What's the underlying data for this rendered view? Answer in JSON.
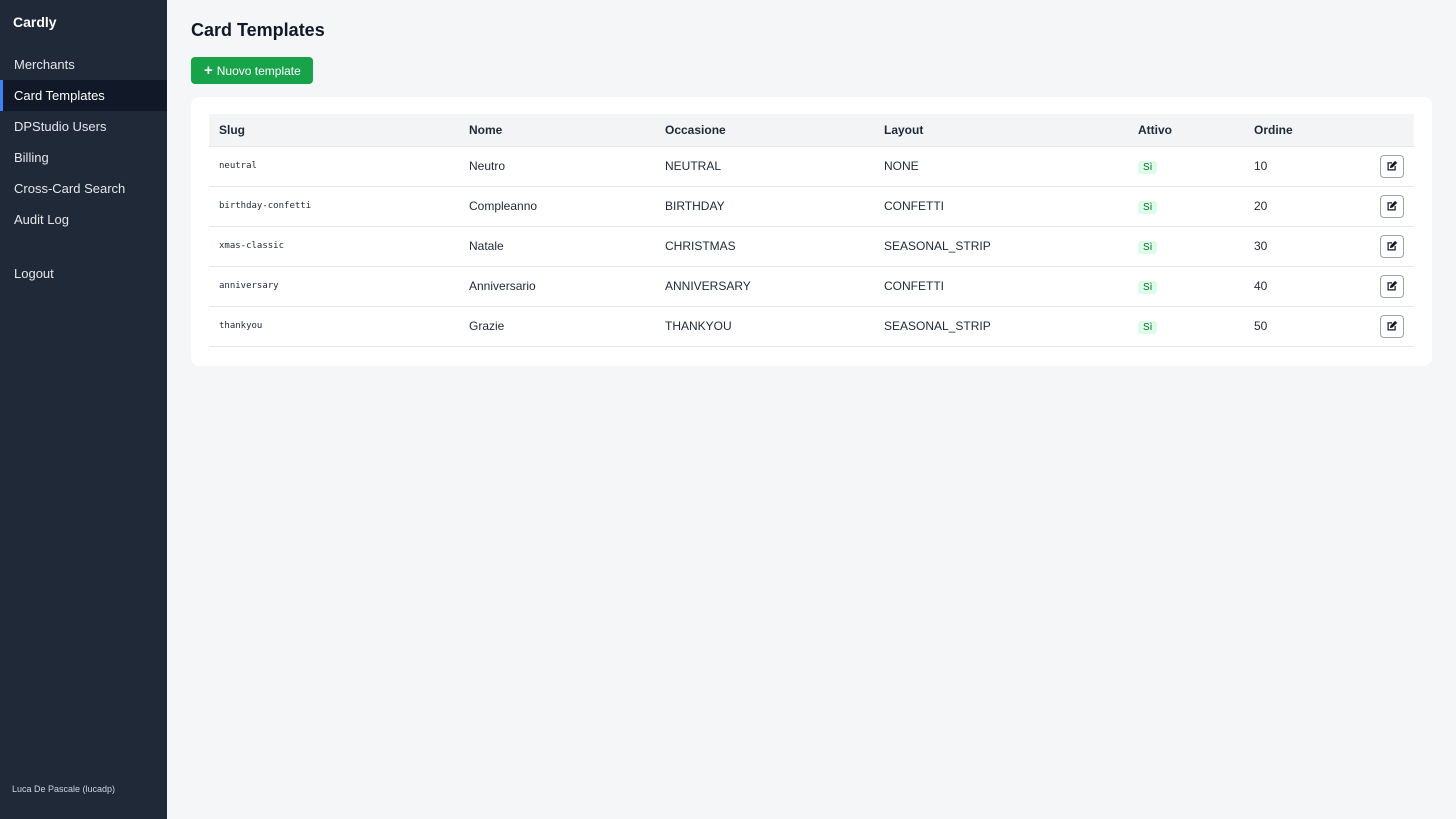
{
  "sidebar": {
    "brand": "Cardly",
    "items": [
      {
        "label": "Merchants"
      },
      {
        "label": "Card Templates",
        "active": true
      },
      {
        "label": "DPStudio Users"
      },
      {
        "label": "Billing"
      },
      {
        "label": "Cross-Card Search"
      },
      {
        "label": "Audit Log"
      }
    ],
    "logout": "Logout",
    "user": "Luca De Pascale (lucadp)"
  },
  "main": {
    "title": "Card Templates",
    "new_button": {
      "icon": "plus-icon",
      "label": "Nuovo template"
    },
    "table": {
      "columns": [
        "Slug",
        "Nome",
        "Occasione",
        "Layout",
        "Attivo",
        "Ordine"
      ],
      "rows": [
        {
          "slug": "neutral",
          "nome": "Neutro",
          "occasione": "NEUTRAL",
          "layout": "NONE",
          "attivo": "Sì",
          "ordine": "10"
        },
        {
          "slug": "birthday-confetti",
          "nome": "Compleanno",
          "occasione": "BIRTHDAY",
          "layout": "CONFETTI",
          "attivo": "Sì",
          "ordine": "20"
        },
        {
          "slug": "xmas-classic",
          "nome": "Natale",
          "occasione": "CHRISTMAS",
          "layout": "SEASONAL_STRIP",
          "attivo": "Sì",
          "ordine": "30"
        },
        {
          "slug": "anniversary",
          "nome": "Anniversario",
          "occasione": "ANNIVERSARY",
          "layout": "CONFETTI",
          "attivo": "Sì",
          "ordine": "40"
        },
        {
          "slug": "thankyou",
          "nome": "Grazie",
          "occasione": "THANKYOU",
          "layout": "SEASONAL_STRIP",
          "attivo": "Sì",
          "ordine": "50"
        }
      ]
    }
  },
  "colors": {
    "sidebar_bg": "#1f2937",
    "accent": "#3b82f6",
    "primary_button": "#16a34a",
    "badge_bg": "#dcfce7"
  }
}
